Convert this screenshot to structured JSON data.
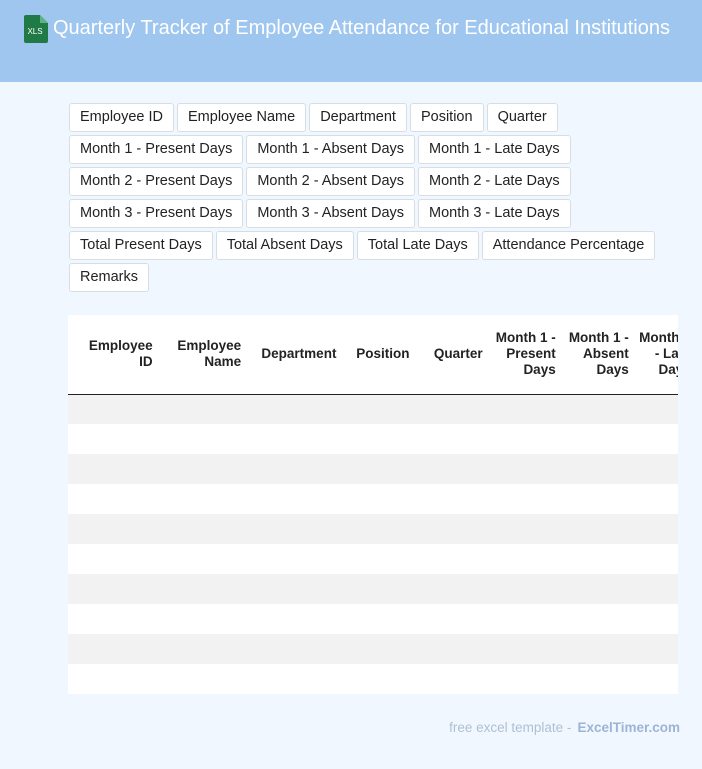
{
  "header": {
    "title": "Quarterly Tracker of Employee Attendance for Educational Institutions",
    "file_badge": "XLS",
    "file_icon_color": "#1f7a45"
  },
  "columns": [
    "Employee ID",
    "Employee Name",
    "Department",
    "Position",
    "Quarter",
    "Month 1 - Present Days",
    "Month 1 - Absent Days",
    "Month 1 - Late Days",
    "Month 2 - Present Days",
    "Month 2 - Absent Days",
    "Month 2 - Late Days",
    "Month 3 - Present Days",
    "Month 3 - Absent Days",
    "Month 3 - Late Days",
    "Total Present Days",
    "Total Absent Days",
    "Total Late Days",
    "Attendance Percentage",
    "Remarks"
  ],
  "table": {
    "headers": [
      "Employee ID",
      "Employee Name",
      "Department",
      "Position",
      "Quarter",
      "Month 1 - Present Days",
      "Month 1 - Absent Days",
      "Month 1 - Late Days",
      "Month 2 - Present Days"
    ],
    "row_count": 10
  },
  "footer": {
    "text": "free excel template -",
    "brand": "ExcelTimer.com"
  },
  "colors": {
    "header_bg": "#9ec6ef",
    "page_bg": "#f1f7fe",
    "row_stripe": "#f2f2f2"
  }
}
